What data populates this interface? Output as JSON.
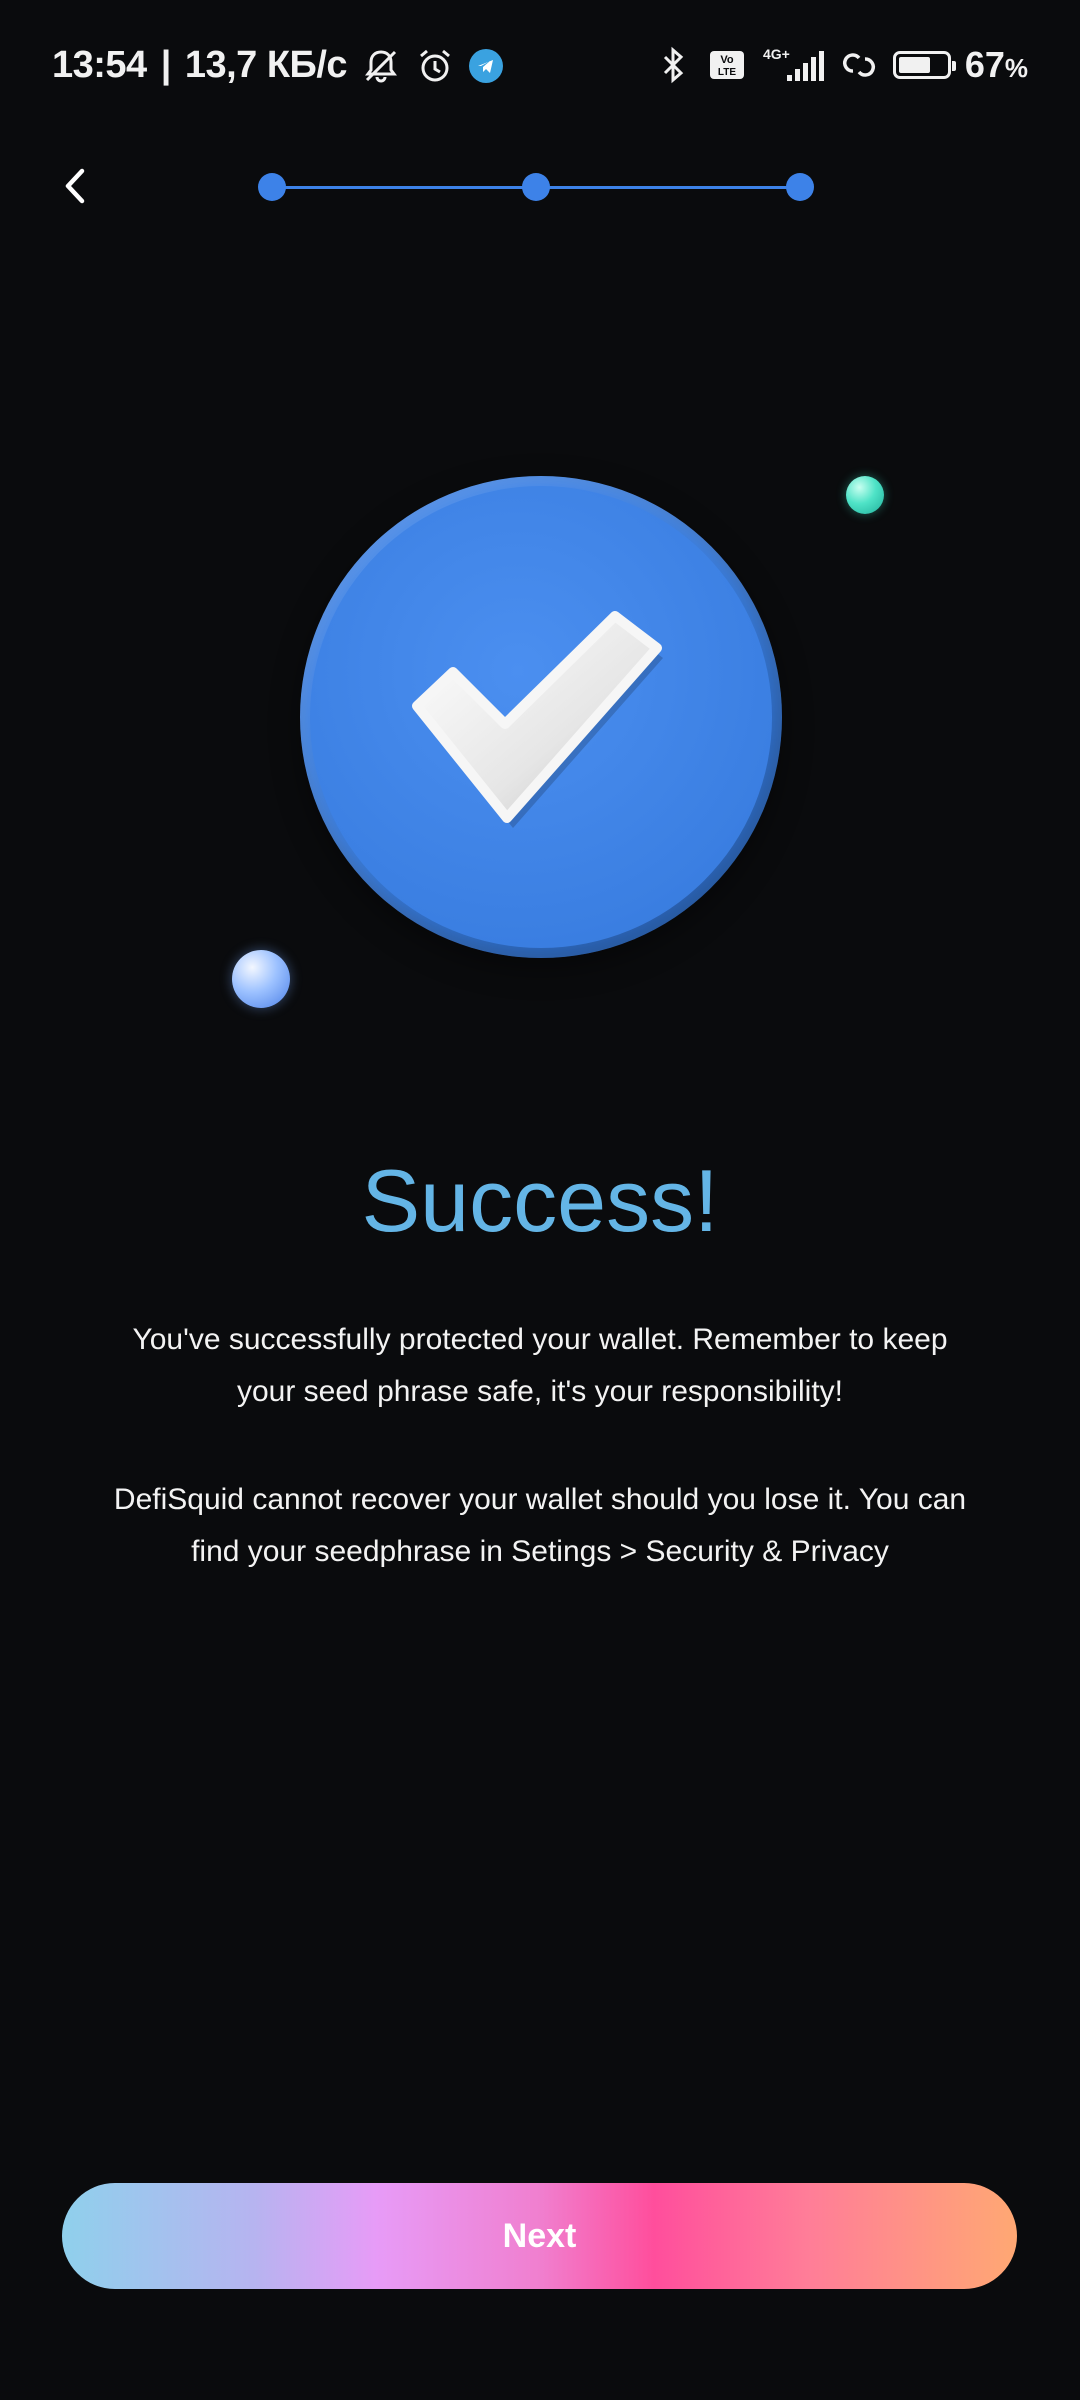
{
  "status_bar": {
    "time": "13:54",
    "separator": "|",
    "network_speed": "13,7 КБ/с",
    "volte_label": "Vo LTE",
    "network_type": "4G+",
    "battery_percent": "67",
    "battery_percent_sign": "%",
    "battery_level": 0.67,
    "icons": [
      "mute-icon",
      "alarm-icon",
      "telegram-icon",
      "bluetooth-icon",
      "volte-icon",
      "signal-icon",
      "hotspot-icon",
      "battery-icon"
    ]
  },
  "nav": {
    "back_icon": "chevron-left-icon",
    "steps_total": 3,
    "steps_completed": 3
  },
  "main": {
    "title": "Success!",
    "paragraph_1": "You've successfully protected your wallet. Remember to keep your seed phrase safe, it's your responsibility!",
    "paragraph_2": "DefiSquid cannot recover your wallet should you lose it. You can find your seedphrase in Setings > Security & Privacy"
  },
  "footer": {
    "next_label": "Next"
  },
  "colors": {
    "background": "#0a0b0d",
    "accent_blue": "#3d82e8",
    "title_color": "#64b5e6"
  }
}
